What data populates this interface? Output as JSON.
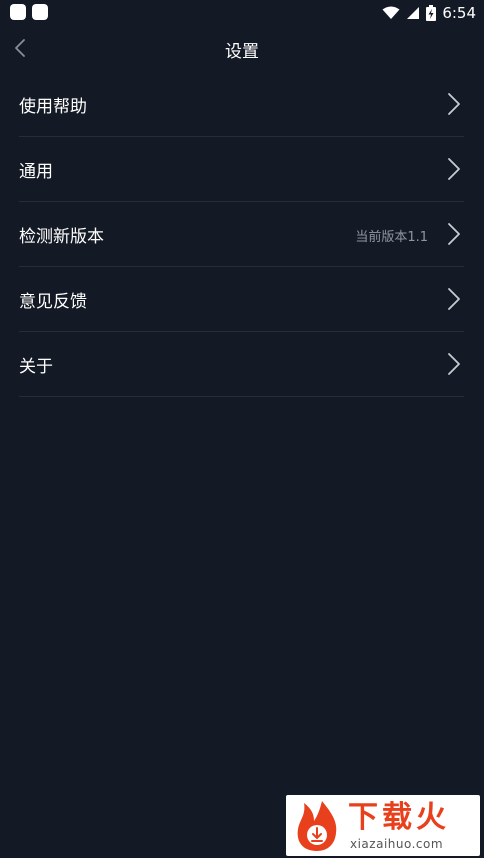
{
  "status_bar": {
    "time": "6:54",
    "icons": [
      "app-notification-icon",
      "app-notification-icon",
      "wifi-icon",
      "cell-signal-icon",
      "battery-charging-icon"
    ]
  },
  "header": {
    "title": "设置",
    "back_icon": "chevron-left-icon"
  },
  "settings": {
    "items": [
      {
        "label": "使用帮助",
        "value": ""
      },
      {
        "label": "通用",
        "value": ""
      },
      {
        "label": "检测新版本",
        "value": "当前版本1.1"
      },
      {
        "label": "意见反馈",
        "value": ""
      },
      {
        "label": "关于",
        "value": ""
      }
    ],
    "chevron_icon": "chevron-right-icon"
  },
  "watermark": {
    "title": "下载火",
    "url": "xiazaihuo.com"
  },
  "colors": {
    "background": "#141a25",
    "divider": "#262d38",
    "text": "#ffffff",
    "secondary_text": "#9096a0",
    "watermark_accent": "#e8401c"
  }
}
